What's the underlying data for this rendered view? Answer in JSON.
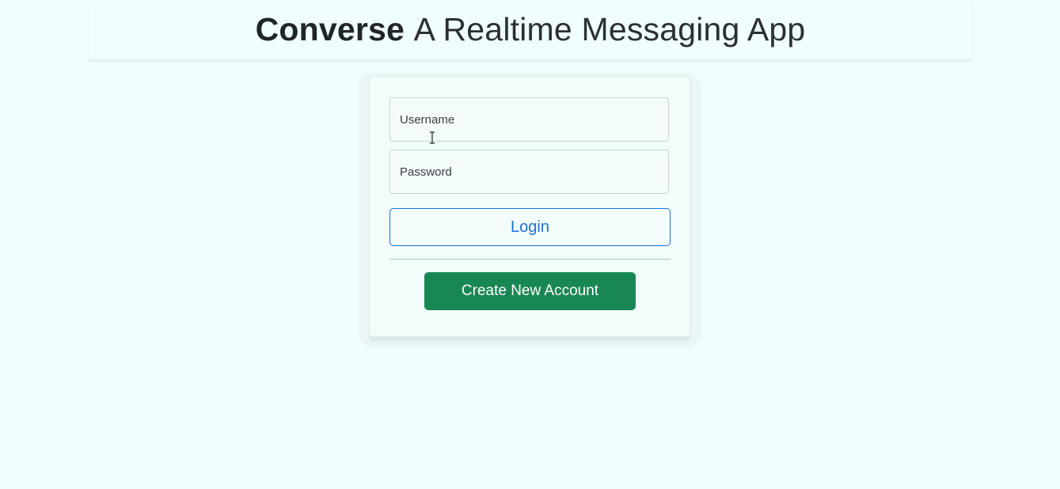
{
  "header": {
    "brand": "Converse",
    "tagline": "A Realtime Messaging App"
  },
  "login_form": {
    "username_placeholder": "Username",
    "password_placeholder": "Password",
    "login_label": "Login",
    "create_account_label": "Create New Account"
  },
  "colors": {
    "background": "#f0fffe",
    "login_accent": "#1f6fd6",
    "create_button": "#198754"
  },
  "icons": {
    "cursor": "text-cursor-icon"
  }
}
